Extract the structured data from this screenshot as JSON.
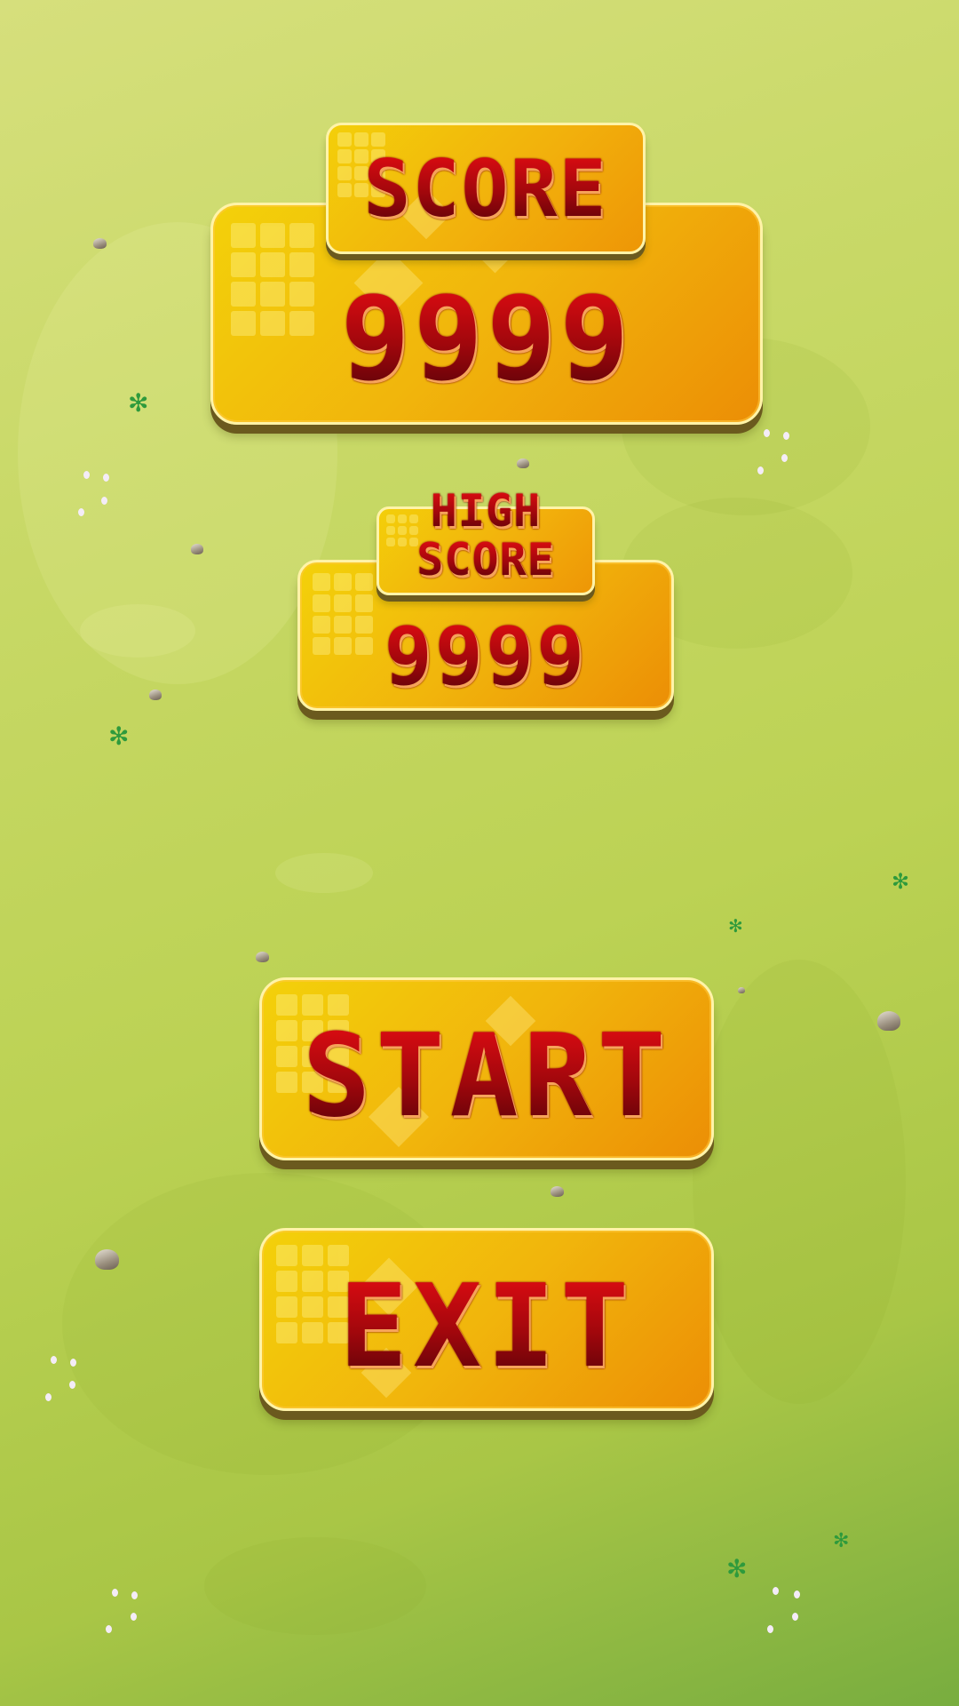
{
  "score": {
    "label": "SCORE",
    "value": "9999"
  },
  "high_score": {
    "label_line1": "HIGH",
    "label_line2": "SCORE",
    "value": "9999"
  },
  "buttons": {
    "start_label": "START",
    "exit_label": "EXIT"
  },
  "colors": {
    "panel_top": "#f3d10a",
    "panel_bottom": "#ec8e05",
    "text_red": "#b4060c",
    "background": "#c9d968"
  },
  "icons": {
    "rock": "rock-icon",
    "grass": "grass-tuft-icon",
    "flower": "flower-icon"
  }
}
